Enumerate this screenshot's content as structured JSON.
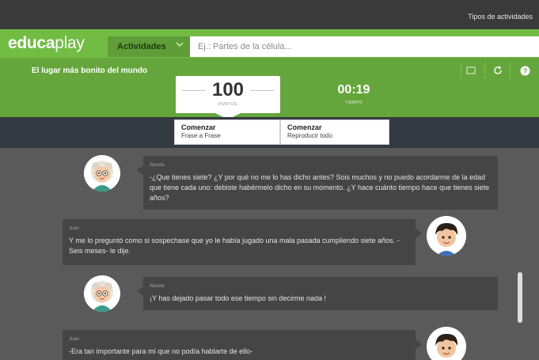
{
  "topbar": {
    "link": "Tipos de actividades"
  },
  "nav": {
    "logo_bold": "educa",
    "logo_light": "play",
    "activities_label": "Actividades",
    "search_placeholder": "Ej.: Partes de la célula..."
  },
  "activity": {
    "title": "El lugar más bonito del mundo",
    "icons": [
      "expand-icon",
      "refresh-icon",
      "help-icon"
    ]
  },
  "score": {
    "value": "100",
    "label": "PUNTOS"
  },
  "timer": {
    "value": "00:19",
    "label": "TIEMPO"
  },
  "controls": [
    {
      "title": "Comenzar",
      "subtitle": "Frase a Frase"
    },
    {
      "title": "Comenzar",
      "subtitle": "Reproducir todo"
    }
  ],
  "messages": [
    {
      "speaker": "Abuela",
      "text": "-¿Que tienes siete? ¿Y por qué no me lo has dicho antes? Sois muchos y no puedo acordarme de la edad que tiene cada uno: debiste habérmelo dicho en su momento. ¿Y hace cuánto tiempo hace que tienes siete años?"
    },
    {
      "speaker": "Juan",
      "text": "Y me lo preguntó como si sospechase que yo le había jugado una mala pasada cumpliendo siete años. -Seis meses- le dije."
    },
    {
      "speaker": "Abuela",
      "text": "¡Y has dejado pasar todo ese tiempo sin decirme nada !"
    },
    {
      "speaker": "Juan",
      "text": "-Era tan importante para mí que no podía hablarte de ello-"
    }
  ],
  "colors": {
    "brand_green": "#72bc44",
    "dark_bar": "#343a42",
    "chat_bg": "#5a5a5a"
  }
}
